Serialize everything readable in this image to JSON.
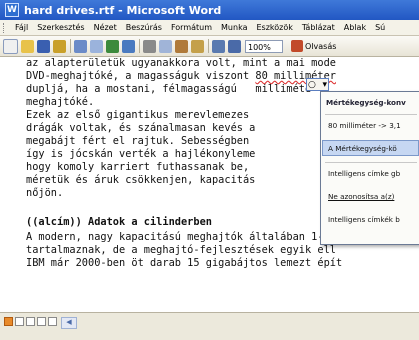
{
  "window": {
    "title": "hard drives.rtf - Microsoft Word",
    "icon": "word-doc-icon"
  },
  "menu": [
    "Fájl",
    "Szerkesztés",
    "Nézet",
    "Beszúrás",
    "Formátum",
    "Munka",
    "Eszközök",
    "Táblázat",
    "Ablak",
    "Sú"
  ],
  "toolbar": {
    "icons": [
      "new-doc-icon",
      "open-icon",
      "save-icon",
      "permission-icon",
      "print-icon",
      "print-preview-icon",
      "spelling-icon",
      "research-icon",
      "cut-icon",
      "copy-icon",
      "paste-icon",
      "format-painter-icon",
      "undo-icon",
      "hyperlink-icon"
    ],
    "zoom": "100%",
    "read_label": "Olvasás"
  },
  "document": {
    "lines": [
      "az alapterületük ugyanakkora volt, mint a mai mode",
      "DVD-meghajtóké, a magasságuk viszont 80 millimeter",
      "dupljá, ha a mostani, félmagasságú   milliméte",
      "meghajtóké.",
      "Ezek az első gigantikus merevlemezes",
      "drágák voltak, és szánalmasan kevés a",
      "megabájt fért el rajtuk. Sebességben",
      "így is jócskán verték a hajlékonyleme",
      "hogy komoly karriert futhassanak be,",
      "méretük és áruk csökkenjen, kapacitás",
      "nőjön.",
      "",
      "((alcím)) Adatok a cilinderben",
      "A modern, nagy kapacitású meghajtók általában 1-3",
      "tartalmaznak, de a meghajtó-fejlesztések egyik ell",
      "IBM már 2000-ben öt darab 15 gigabájtos lemezt épít"
    ],
    "heading": "((alcím)) Adatok a cilinderben"
  },
  "smart_tag_menu": {
    "items": [
      "Mértékegység-konv",
      "80 milliméter -> 3,1",
      "A Mértékegység-kö",
      "Intelligens címke gb",
      "Ne azonosítsa a(z)",
      "Intelligens címkék b"
    ]
  },
  "statusbar": {
    "views": [
      "normal-view-icon",
      "web-view-icon",
      "print-layout-icon",
      "outline-view-icon",
      "reading-view-icon"
    ]
  }
}
